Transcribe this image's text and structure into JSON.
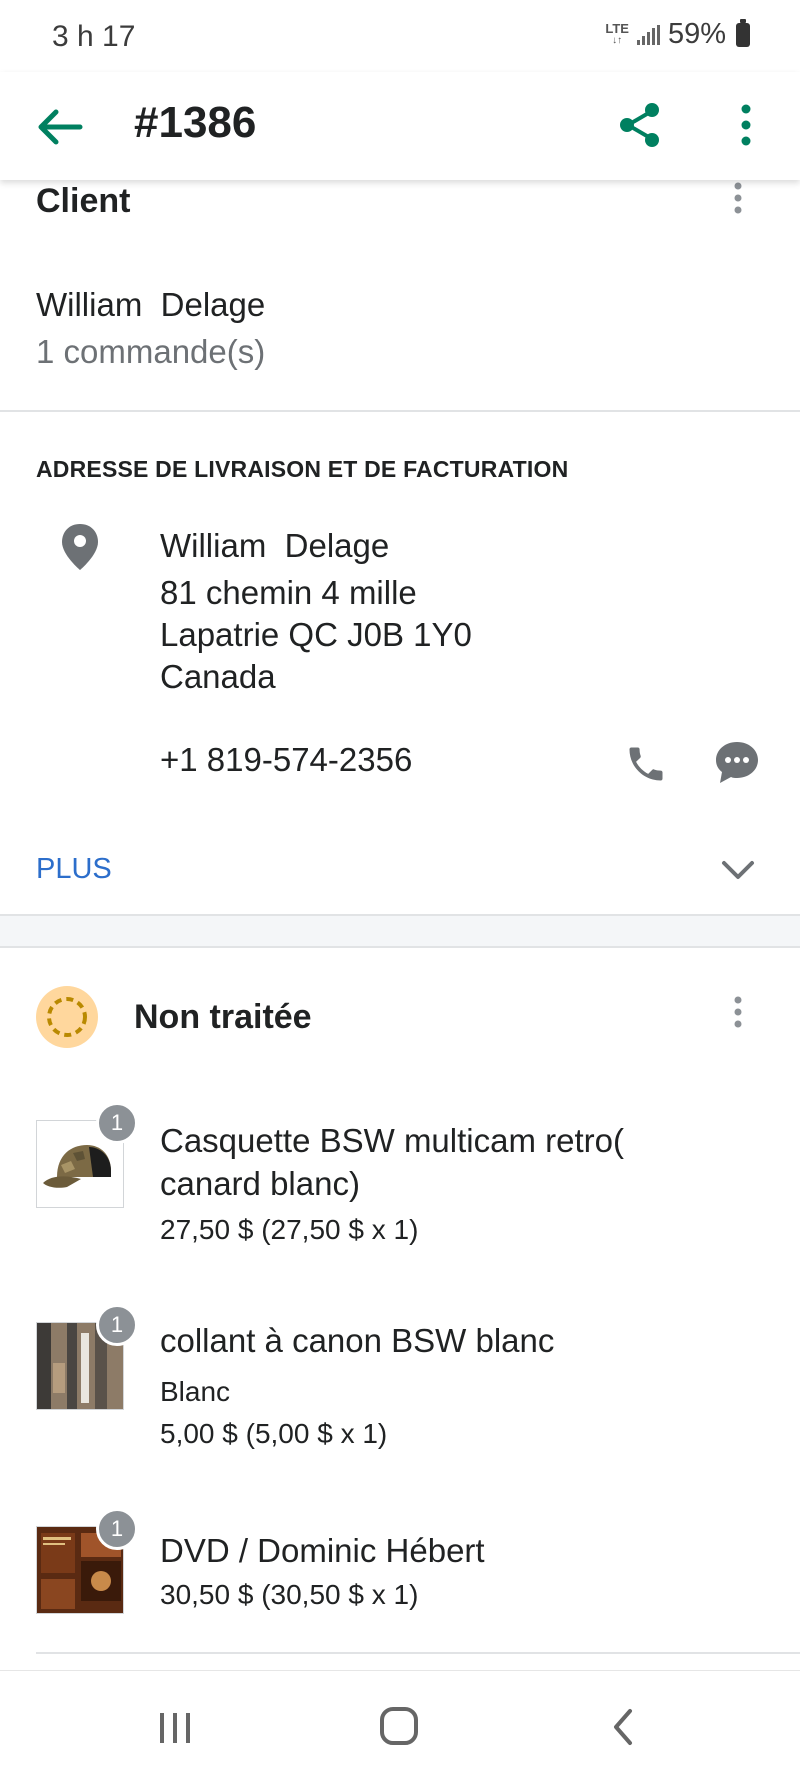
{
  "status_bar": {
    "time": "3 h 17",
    "network": "LTE",
    "battery": "59%"
  },
  "header": {
    "title": "#1386",
    "back_icon": "arrow-left-icon",
    "share_icon": "share-icon",
    "more_icon": "more-vertical-icon"
  },
  "client": {
    "section_title": "Client",
    "name": "William  Delage",
    "orders_count": "1 commande(s)"
  },
  "address": {
    "heading": "ADRESSE DE LIVRAISON ET DE FACTURATION",
    "name": "William  Delage",
    "street": "81 chemin 4 mille",
    "city_line": "Lapatrie QC J0B 1Y0",
    "country": "Canada",
    "phone": "+1 819-574-2356",
    "more_label": "PLUS"
  },
  "fulfillment": {
    "status_label": "Non traitée",
    "status_color": "#ffd79d",
    "items": [
      {
        "title": "Casquette BSW multicam retro( canard blanc)",
        "variant": "",
        "price": "27,50 $ (27,50 $ x 1)",
        "quantity": "1",
        "thumb_icon": "cap-image"
      },
      {
        "title": "collant à canon BSW blanc",
        "variant": "Blanc",
        "price": "5,00 $ (5,00 $ x 1)",
        "quantity": "1",
        "thumb_icon": "barrel-sticker-image"
      },
      {
        "title": "DVD / Dominic Hébert",
        "variant": "",
        "price": "30,50 $ (30,50 $ x 1)",
        "quantity": "1",
        "thumb_icon": "dvd-cover-image"
      }
    ]
  },
  "colors": {
    "accent_green": "#008060",
    "link_blue": "#2c6ecb",
    "badge_gray": "#8c9196"
  }
}
